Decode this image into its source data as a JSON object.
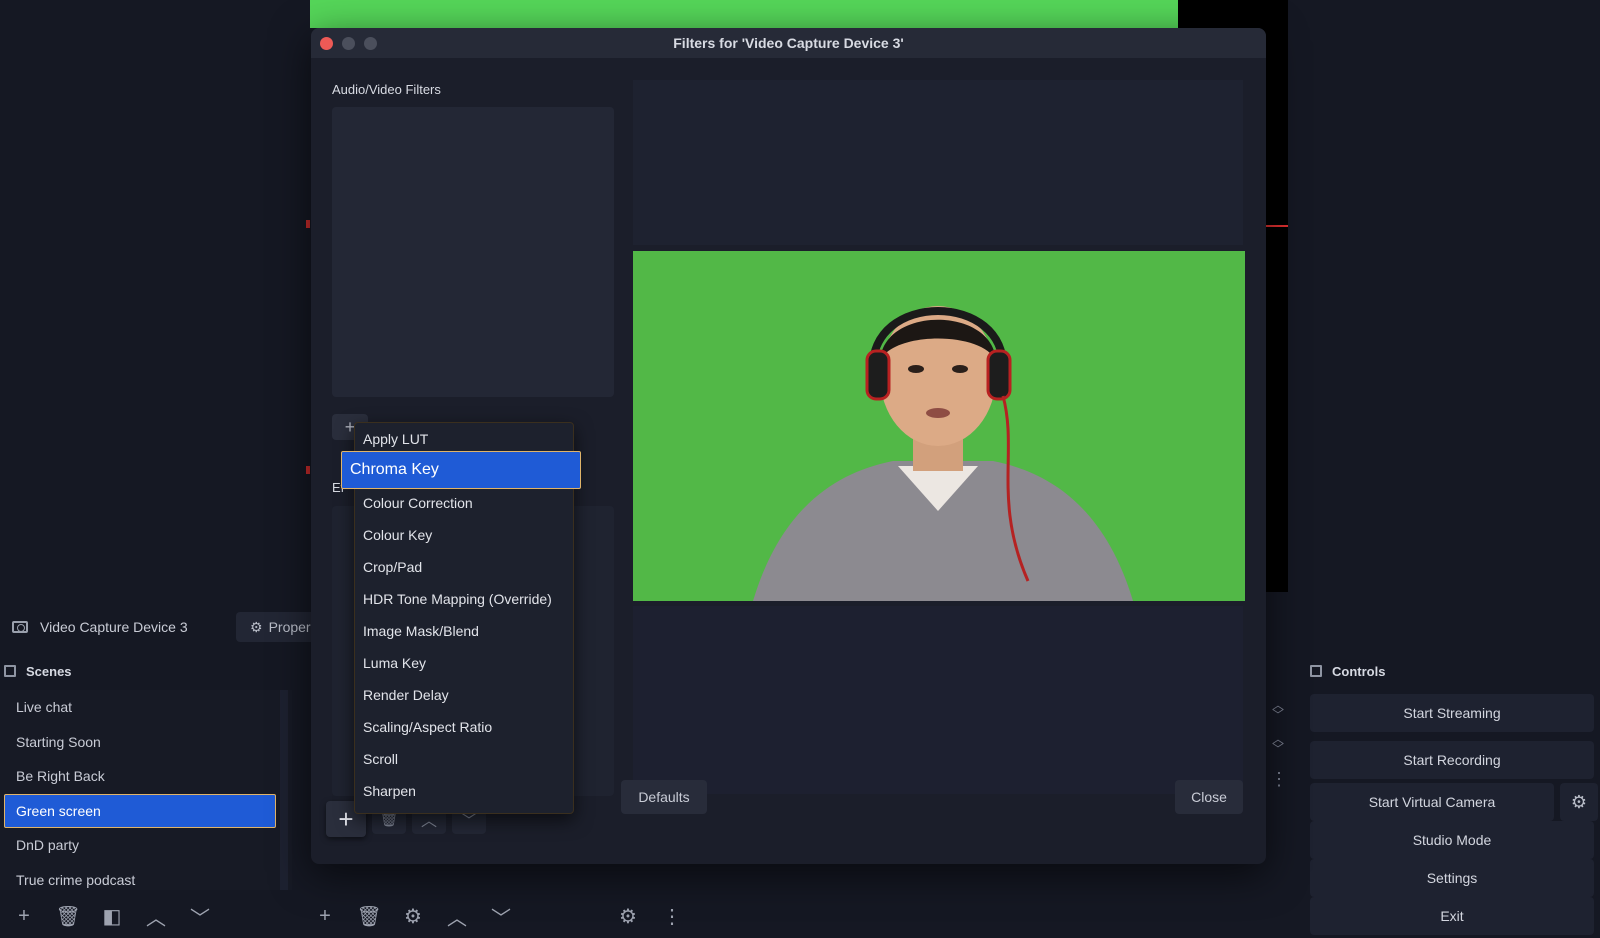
{
  "dialog": {
    "title": "Filters for 'Video Capture Device 3'",
    "av_filters_label": "Audio/Video Filters",
    "effect_filters_label_partial": "Ef",
    "defaults_label": "Defaults",
    "close_label": "Close"
  },
  "menu": {
    "items": [
      "Apply LUT",
      "Chroma Key",
      "Colour Correction",
      "Colour Key",
      "Crop/Pad",
      "HDR Tone Mapping (Override)",
      "Image Mask/Blend",
      "Luma Key",
      "Render Delay",
      "Scaling/Aspect Ratio",
      "Scroll",
      "Sharpen"
    ],
    "highlighted": "Chroma Key"
  },
  "source_bar": {
    "source_name": "Video Capture Device 3",
    "properties_label": "Proper"
  },
  "scenes": {
    "header": "Scenes",
    "items": [
      "Live chat",
      "Starting Soon",
      "Be Right Back",
      "Green screen",
      "DnD party",
      "True crime podcast"
    ],
    "selected": "Green screen"
  },
  "controls": {
    "header": "Controls",
    "start_streaming": "Start Streaming",
    "start_recording": "Start Recording",
    "start_virtual_camera": "Start Virtual Camera",
    "studio_mode": "Studio Mode",
    "settings": "Settings",
    "exit": "Exit"
  },
  "colors": {
    "accent": "#1f5bd6",
    "chroma_green": "#52b847",
    "close_dot": "#ed5a56"
  },
  "icons": [
    "camera-icon",
    "gear-icon",
    "plus-icon",
    "trash-icon",
    "chevron-up-icon",
    "chevron-down-icon",
    "filter-icon",
    "more-icon"
  ]
}
